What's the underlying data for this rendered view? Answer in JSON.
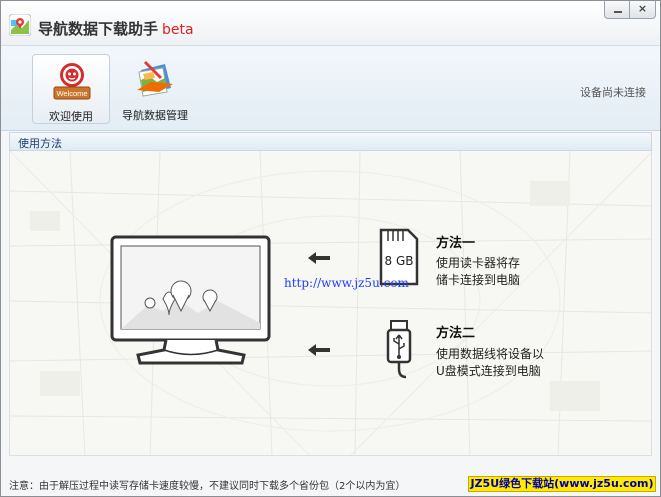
{
  "window": {
    "title": "导航数据下载助手",
    "title_suffix": "beta",
    "minimize_icon": "minimize-icon",
    "close_icon": "close-icon",
    "close_glyph": "×"
  },
  "toolbar": {
    "items": [
      {
        "label": "欢迎使用",
        "icon": "welcome-icon",
        "badge": "Welcome",
        "active": true
      },
      {
        "label": "导航数据管理",
        "icon": "map-folder-icon",
        "active": false
      }
    ],
    "device_status": "设备尚未连接"
  },
  "section": {
    "title": "使用方法"
  },
  "methods": [
    {
      "title": "方法一",
      "desc_lines": [
        "使用读卡器将存",
        "储卡连接到电脑"
      ],
      "icon": "sd-card-icon",
      "card_label": "8 GB"
    },
    {
      "title": "方法二",
      "desc_lines": [
        "使用数据线将设备以",
        "U盘模式连接到电脑"
      ],
      "icon": "usb-cable-icon"
    }
  ],
  "illustration": {
    "icon": "monitor-icon"
  },
  "watermark": {
    "url": "http://www.jz5u.com"
  },
  "footer": {
    "note": "注意：由于解压过程中读写存储卡速度较慢，不建议同时下载多个省份包（2个以内为宜）",
    "site_badge": "JZ5U绿色下载站(www.jz5u.com)"
  },
  "colors": {
    "accent_red": "#e02020",
    "badge_yellow": "#ffea00",
    "link_blue": "#1e3cff"
  }
}
